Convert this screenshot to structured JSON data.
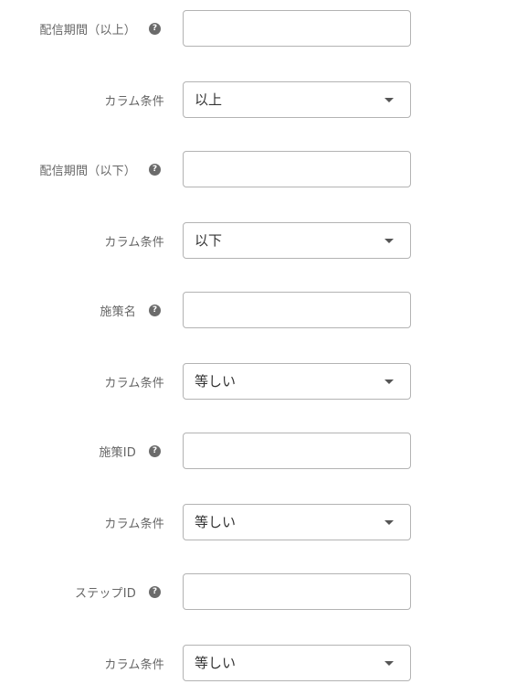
{
  "fields": [
    {
      "label": "配信期間（以上）",
      "help_icon": "question-circle-icon",
      "type": "text",
      "value": ""
    },
    {
      "label": "カラム条件",
      "type": "select",
      "value": "以上"
    },
    {
      "label": "配信期間（以下）",
      "help_icon": "question-circle-icon",
      "type": "text",
      "value": ""
    },
    {
      "label": "カラム条件",
      "type": "select",
      "value": "以下"
    },
    {
      "label": "施策名",
      "help_icon": "question-circle-icon",
      "type": "text",
      "value": ""
    },
    {
      "label": "カラム条件",
      "type": "select",
      "value": "等しい"
    },
    {
      "label": "施策ID",
      "help_icon": "question-circle-icon",
      "type": "text",
      "value": ""
    },
    {
      "label": "カラム条件",
      "type": "select",
      "value": "等しい"
    },
    {
      "label": "ステップID",
      "help_icon": "question-circle-icon",
      "type": "text",
      "value": ""
    },
    {
      "label": "カラム条件",
      "type": "select",
      "value": "等しい"
    }
  ],
  "help_glyph": "?",
  "colors": {
    "label": "#666666",
    "border": "#b3b3b3",
    "help_icon_bg": "#6b6b6b"
  }
}
